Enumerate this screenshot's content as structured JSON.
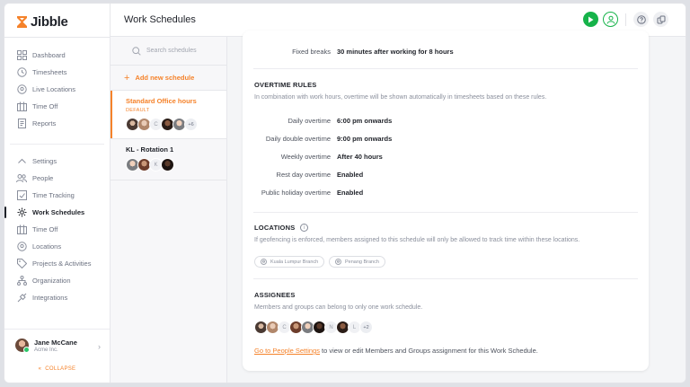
{
  "app": {
    "name": "Jibble",
    "brand_color": "#f5822a",
    "success_color": "#16b34a"
  },
  "sidebar": {
    "items_top": [
      {
        "label": "Dashboard",
        "icon": "dashboard-icon"
      },
      {
        "label": "Timesheets",
        "icon": "timesheets-icon"
      },
      {
        "label": "Live Locations",
        "icon": "location-pin-icon"
      },
      {
        "label": "Time Off",
        "icon": "time-off-icon"
      },
      {
        "label": "Reports",
        "icon": "reports-icon"
      }
    ],
    "settings_label": "Settings",
    "items_settings": [
      {
        "label": "People",
        "icon": "people-icon"
      },
      {
        "label": "Time Tracking",
        "icon": "time-tracking-icon"
      },
      {
        "label": "Work Schedules",
        "icon": "work-schedules-icon",
        "active": true
      },
      {
        "label": "Time Off",
        "icon": "time-off-icon"
      },
      {
        "label": "Locations",
        "icon": "location-pin-icon"
      },
      {
        "label": "Projects & Activities",
        "icon": "tag-icon"
      },
      {
        "label": "Organization",
        "icon": "organization-icon"
      },
      {
        "label": "Integrations",
        "icon": "integrations-icon"
      }
    ],
    "user": {
      "name": "Jane McCane",
      "org": "Acme Inc."
    },
    "collapse_label": "COLLAPSE"
  },
  "header": {
    "title": "Work Schedules"
  },
  "schedules": {
    "search_placeholder": "Search schedules",
    "add_label": "Add new schedule",
    "items": [
      {
        "name": "Standard Office hours",
        "badge": "DEFAULT",
        "letter": "C",
        "more": "+6"
      },
      {
        "name": "KL - Rotation 1",
        "letter": "K"
      }
    ]
  },
  "detail": {
    "fixed_breaks": {
      "label": "Fixed breaks",
      "value": "30 minutes after working for 8 hours"
    },
    "overtime": {
      "title": "OVERTIME RULES",
      "description": "In combination with work hours, overtime will be shown automatically in timesheets based on these rules.",
      "rules": [
        {
          "label": "Daily overtime",
          "value": "6:00 pm onwards"
        },
        {
          "label": "Daily double overtime",
          "value": "9:00 pm onwards"
        },
        {
          "label": "Weekly overtime",
          "value": "After 40 hours"
        },
        {
          "label": "Rest day overtime",
          "value": "Enabled"
        },
        {
          "label": "Public holiday overtime",
          "value": "Enabled"
        }
      ]
    },
    "locations": {
      "title": "LOCATIONS",
      "description": "If geofencing is enforced, members assigned to this schedule will only be allowed to track time within these locations.",
      "chips": [
        "Kuala Lumpur Branch",
        "Penang Branch"
      ]
    },
    "assignees": {
      "title": "ASSIGNEES",
      "description": "Members and groups can belong to only one work schedule.",
      "letters": [
        "C",
        "N",
        "L"
      ],
      "more": "+2",
      "link_text": "Go to People Settings",
      "note_rest": " to view or edit Members and Groups assignment for this Work Schedule."
    }
  }
}
